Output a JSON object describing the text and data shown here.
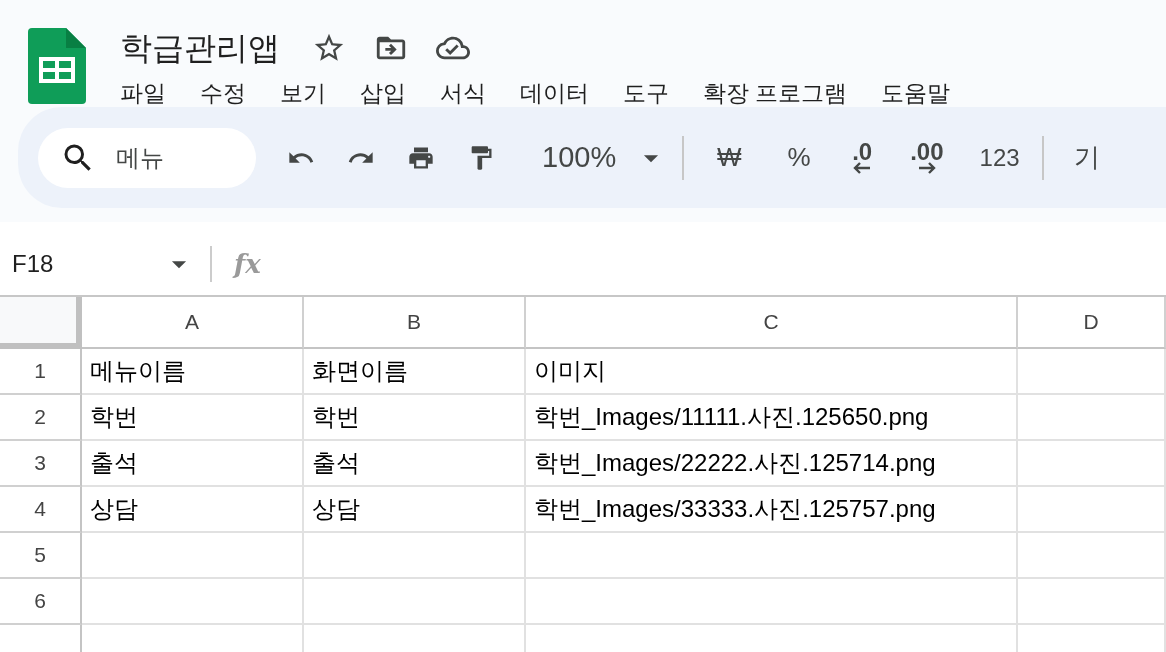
{
  "app": {
    "title": "학급관리앱"
  },
  "menu": [
    "파일",
    "수정",
    "보기",
    "삽입",
    "서식",
    "데이터",
    "도구",
    "확장 프로그램",
    "도움말"
  ],
  "toolbar": {
    "search": {
      "placeholder": "메뉴"
    },
    "zoom": "100%",
    "currency": "₩",
    "percent": "%",
    "decimal_decrease": ".0",
    "decimal_increase": ".00",
    "number_format": "123",
    "format_cut": "기"
  },
  "formula_bar": {
    "cell_ref": "F18",
    "function_label": "fx"
  },
  "sheet": {
    "columns": [
      "A",
      "B",
      "C",
      "D"
    ],
    "rows": [
      {
        "number": "1",
        "cells": [
          "메뉴이름",
          "화면이름",
          "이미지"
        ]
      },
      {
        "number": "2",
        "cells": [
          "학번",
          "학번",
          "학번_Images/11111.사진.125650.png"
        ]
      },
      {
        "number": "3",
        "cells": [
          "출석",
          "출석",
          "학번_Images/22222.사진.125714.png"
        ]
      },
      {
        "number": "4",
        "cells": [
          "상담",
          "상담",
          "학번_Images/33333.사진.125757.png"
        ]
      },
      {
        "number": "5"
      },
      {
        "number": "6"
      },
      {}
    ]
  }
}
